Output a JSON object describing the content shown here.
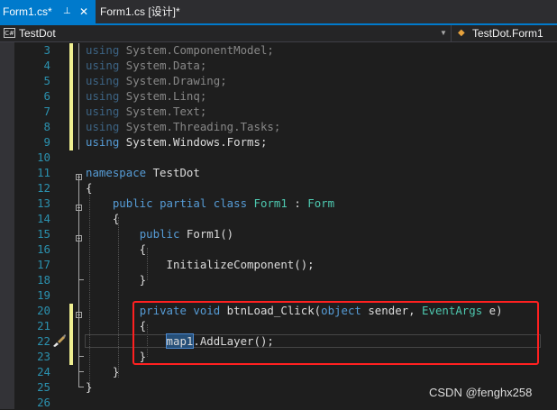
{
  "tabs": [
    {
      "label": "Form1.cs*",
      "active": true
    },
    {
      "label": "Form1.cs [设计]*",
      "active": false
    }
  ],
  "tab_icons": {
    "pin": "⊥",
    "close": "✕"
  },
  "navbar": {
    "left_badge": "C#",
    "left_label": "TestDot",
    "right_label": "TestDot.Form1"
  },
  "code": [
    {
      "n": "3",
      "text": "using System.ComponentModel;"
    },
    {
      "n": "4",
      "text": "using System.Data;"
    },
    {
      "n": "5",
      "text": "using System.Drawing;"
    },
    {
      "n": "6",
      "text": "using System.Linq;"
    },
    {
      "n": "7",
      "text": "using System.Text;"
    },
    {
      "n": "8",
      "text": "using System.Threading.Tasks;"
    },
    {
      "n": "9",
      "text": "using System.Windows.Forms;"
    },
    {
      "n": "10",
      "text": ""
    },
    {
      "n": "11",
      "text": "namespace TestDot"
    },
    {
      "n": "12",
      "text": "{"
    },
    {
      "n": "13",
      "text": "    public partial class Form1 : Form"
    },
    {
      "n": "14",
      "text": "    {"
    },
    {
      "n": "15",
      "text": "        public Form1()"
    },
    {
      "n": "16",
      "text": "        {"
    },
    {
      "n": "17",
      "text": "            InitializeComponent();"
    },
    {
      "n": "18",
      "text": "        }"
    },
    {
      "n": "19",
      "text": ""
    },
    {
      "n": "20",
      "text": "        private void btnLoad_Click(object sender, EventArgs e)"
    },
    {
      "n": "21",
      "text": "        {"
    },
    {
      "n": "22",
      "text": "            map1.AddLayer();"
    },
    {
      "n": "23",
      "text": "        }"
    },
    {
      "n": "24",
      "text": "    }"
    },
    {
      "n": "25",
      "text": "}"
    },
    {
      "n": "26",
      "text": ""
    }
  ],
  "watermark": "CSDN @fenghx258",
  "colors": {
    "keyword": "#569cd6",
    "type": "#4ec9b0",
    "line_number": "#2b91af",
    "highlight_box": "#ff2020",
    "active_tab": "#007acc"
  }
}
